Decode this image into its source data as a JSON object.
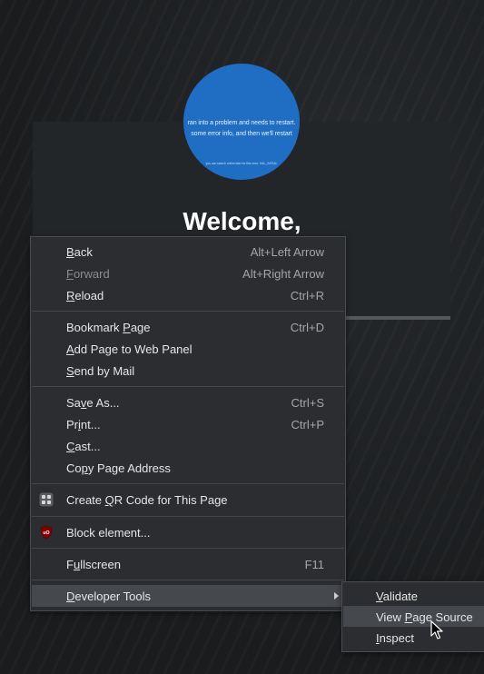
{
  "page": {
    "welcome_text": "Welcome,",
    "avatar_lines": [
      "ran into a problem and needs to restart.",
      "some error info, and then we'll restart",
      "you can search online later for this error: HAL_INITIAL"
    ]
  },
  "context_menu": {
    "back": {
      "label": "Back",
      "mnemonic_index": 0,
      "shortcut": "Alt+Left Arrow"
    },
    "forward": {
      "label": "Forward",
      "shortcut": "Alt+Right Arrow",
      "disabled": true
    },
    "reload": {
      "label": "Reload",
      "shortcut": "Ctrl+R"
    },
    "bookmark_page": {
      "label": "Bookmark Page",
      "shortcut": "Ctrl+D"
    },
    "add_to_web_panel": {
      "label": "Add Page to Web Panel"
    },
    "send_by_mail": {
      "label": "Send by Mail"
    },
    "save_as": {
      "label": "Save As...",
      "shortcut": "Ctrl+S"
    },
    "print": {
      "label": "Print...",
      "shortcut": "Ctrl+P"
    },
    "cast": {
      "label": "Cast..."
    },
    "copy_address": {
      "label": "Copy Page Address"
    },
    "create_qr": {
      "label": "Create QR Code for This Page",
      "icon": "qr-code-icon"
    },
    "block_element": {
      "label": "Block element...",
      "icon": "ublock-origin-icon",
      "icon_color": "#800000"
    },
    "fullscreen": {
      "label": "Fullscreen",
      "shortcut": "F11"
    },
    "developer_tools": {
      "label": "Developer Tools",
      "highlighted": true,
      "has_submenu": true
    }
  },
  "developer_submenu": {
    "validate": {
      "label": "Validate"
    },
    "view_source": {
      "label": "View Page Source",
      "highlighted": true
    },
    "inspect": {
      "label": "Inspect"
    }
  },
  "colors": {
    "menu_bg": "#2b2d31",
    "highlight_bg": "#45484d",
    "avatar_blue": "#1f6ec4"
  }
}
